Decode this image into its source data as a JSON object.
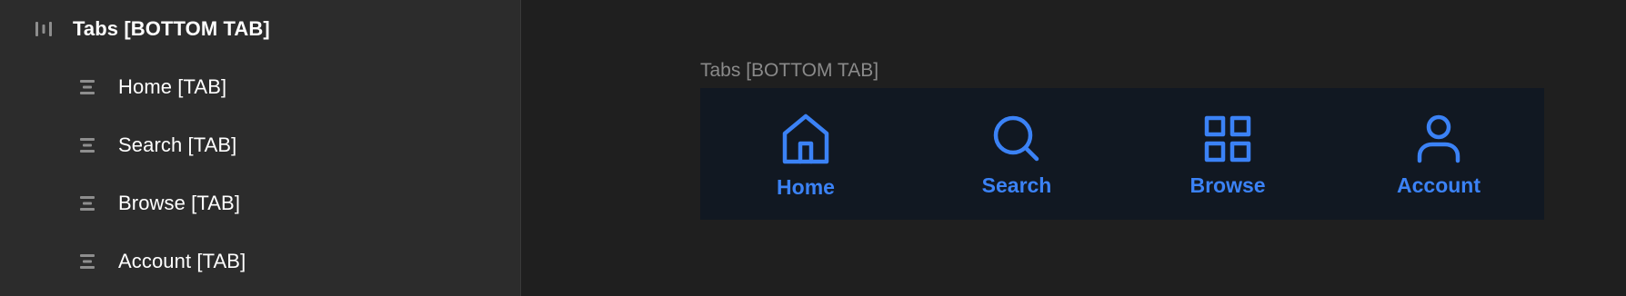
{
  "layers": {
    "parent": {
      "label": "Tabs [BOTTOM TAB]",
      "icon": "columns-layout-icon"
    },
    "children": [
      {
        "label": "Home [TAB]",
        "icon": "rows-layout-icon"
      },
      {
        "label": "Search [TAB]",
        "icon": "rows-layout-icon"
      },
      {
        "label": "Browse [TAB]",
        "icon": "rows-layout-icon"
      },
      {
        "label": "Account [TAB]",
        "icon": "rows-layout-icon"
      }
    ]
  },
  "canvas": {
    "frame_label": "Tabs [BOTTOM TAB]",
    "tabs": [
      {
        "label": "Home",
        "icon": "home-icon"
      },
      {
        "label": "Search",
        "icon": "search-icon"
      },
      {
        "label": "Browse",
        "icon": "grid-icon"
      },
      {
        "label": "Account",
        "icon": "user-icon"
      }
    ]
  },
  "colors": {
    "accent": "#3b82f6",
    "panel_bg": "#2c2c2c",
    "canvas_bg": "#1f1f1f",
    "tabbar_bg": "#111822",
    "muted_text": "#8a8a8a"
  }
}
